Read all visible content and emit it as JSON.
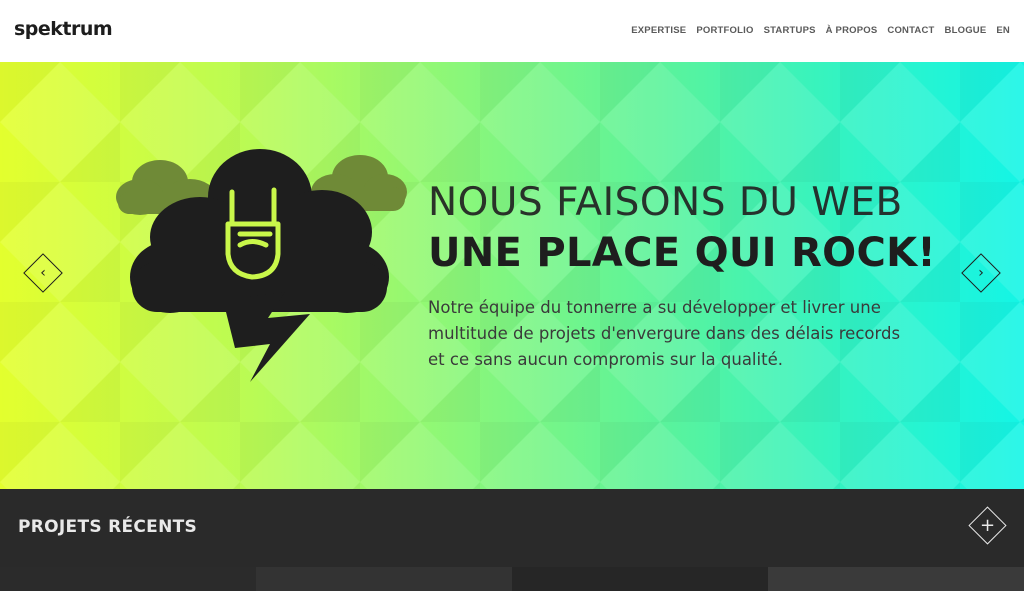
{
  "header": {
    "logo_text": "spektrum",
    "nav": [
      {
        "label": "EXPERTISE"
      },
      {
        "label": "PORTFOLIO"
      },
      {
        "label": "STARTUPS"
      },
      {
        "label": "À PROPOS"
      },
      {
        "label": "CONTACT"
      },
      {
        "label": "BLOGUE"
      },
      {
        "label": "EN"
      }
    ]
  },
  "hero": {
    "headline_line1": "NOUS FAISONS DU WEB",
    "headline_line2": "UNE PLACE QUI ROCK!",
    "body": "Notre équipe du tonnerre a su développer et livrer une multitude de projets d'envergure dans des délais records et ce sans aucun compromis sur la qualité.",
    "prev_icon": "chevron-left-icon",
    "next_icon": "chevron-right-icon",
    "illustration": "storm-cloud-rock-hand-lightning-icon",
    "colors": {
      "gradient_start": "#e3ff2e",
      "gradient_end": "#14f5e6",
      "ink": "#1e1e1e"
    }
  },
  "projects": {
    "title": "PROJETS RÉCENTS",
    "expand_icon": "plus-icon"
  }
}
